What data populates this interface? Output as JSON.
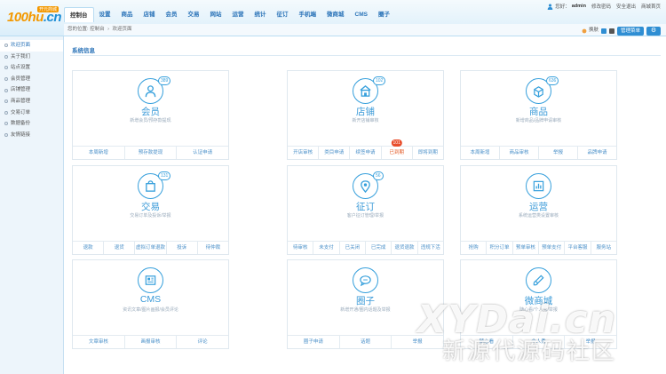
{
  "logo": {
    "main": "100hu",
    "suffix": ".cn",
    "badge": "开元商城"
  },
  "nav": [
    "控制台",
    "设置",
    "商品",
    "店铺",
    "会员",
    "交易",
    "网站",
    "运营",
    "统计",
    "征订",
    "手机端",
    "微商城",
    "CMS",
    "圈子"
  ],
  "user": {
    "greeting": "您好：",
    "name": "admin",
    "links": [
      "修改密码",
      "安全退出",
      "商城首页"
    ]
  },
  "breadcrumb": {
    "prefix": "您的位置:",
    "items": [
      "控制台",
      "欢迎页面"
    ]
  },
  "tools": {
    "skin_label": "换肤",
    "manage_menu": "管理菜单",
    "gear": "⚙"
  },
  "sidebar": [
    "欢迎页面",
    "关于我们",
    "站点设置",
    "会员管理",
    "店铺管理",
    "商品管理",
    "交易订单",
    "数据备份",
    "友情链接"
  ],
  "section_title": "系统信息",
  "cards": [
    {
      "title": "会员",
      "desc": "新增会员/预存款提现",
      "count": "389",
      "icon": "user-icon",
      "actions": [
        "本周新增",
        "预存款提现",
        "认证申请"
      ]
    },
    {
      "title": "店铺",
      "desc": "新开店铺审核",
      "count": "102",
      "icon": "shop-icon",
      "actions": [
        "开店审核",
        "类目申请",
        "续签申请",
        "已到期",
        "即将到期"
      ],
      "hot_index": 3,
      "hot_badge": "101"
    },
    {
      "title": "商品",
      "desc": "新增商品/品牌申请审核",
      "count": "636",
      "icon": "goods-icon",
      "actions": [
        "本周新增",
        "商品审核",
        "举报",
        "品牌申请"
      ]
    },
    {
      "title": "交易",
      "desc": "交易订单及投诉/举报",
      "count": "131",
      "icon": "bag-icon",
      "actions": [
        "退款",
        "退货",
        "虚拟订单退款",
        "投诉",
        "待仲裁"
      ]
    },
    {
      "title": "征订",
      "desc": "客户征订管理/举报",
      "count": "56",
      "icon": "location-icon",
      "actions": [
        "待审核",
        "未支付",
        "已关闭",
        "已完成",
        "退货退款",
        "违规下活"
      ]
    },
    {
      "title": "运营",
      "desc": "系统运营类设置审核",
      "count": "",
      "icon": "operations-icon",
      "actions": [
        "抢购",
        "积分订单",
        "预单审核",
        "预单支付",
        "平台客服",
        "服务站"
      ]
    },
    {
      "title": "CMS",
      "desc": "资讯文章/图片画报/会员评论",
      "count": "",
      "icon": "cms-icon",
      "actions": [
        "文章审核",
        "画报审核",
        "评论"
      ]
    },
    {
      "title": "圈子",
      "desc": "新增开通/圈内话题及举报",
      "count": "",
      "icon": "chat-icon",
      "actions": [
        "圈子申请",
        "话题",
        "举报"
      ]
    },
    {
      "title": "微商城",
      "desc": "随心看/个人秀/举报",
      "count": "",
      "icon": "brush-icon",
      "actions": [
        "随心看",
        "个人秀",
        "举报"
      ]
    }
  ],
  "watermark": {
    "line1": "XYDai.cn",
    "line2": "新源代源码社区"
  },
  "colors": {
    "accent": "#37a0dc",
    "nav_text": "#2a73b8",
    "alert": "#e84d2b",
    "logo_orange": "#f39800"
  }
}
